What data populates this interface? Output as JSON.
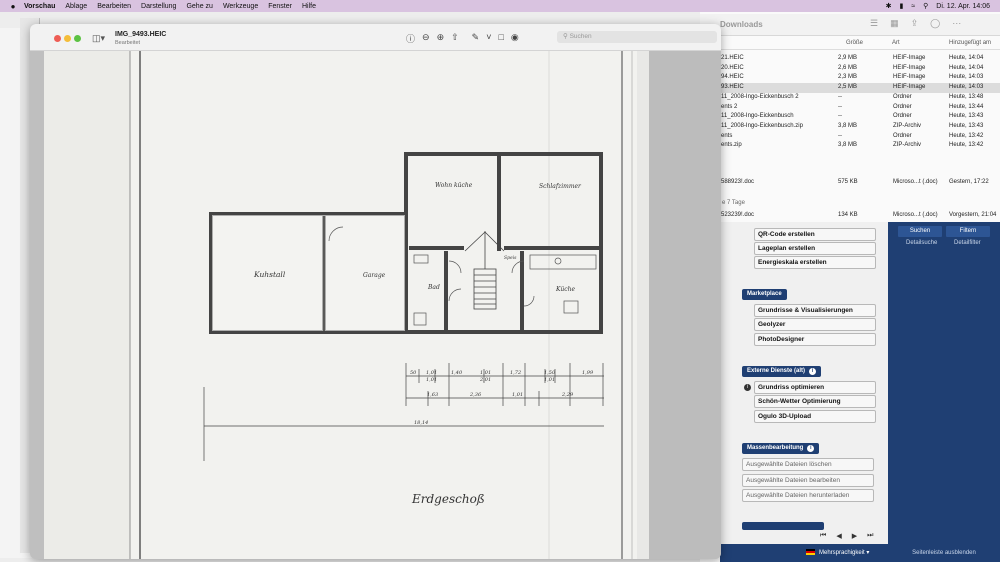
{
  "menubar": {
    "app": "Vorschau",
    "items": [
      "Ablage",
      "Bearbeiten",
      "Darstellung",
      "Gehe zu",
      "Werkzeuge",
      "Fenster",
      "Hilfe"
    ],
    "clock": "Di. 12. Apr.  14:06"
  },
  "preview": {
    "title": "IMG_9493.HEIC",
    "subtitle": "Bearbeitet",
    "search_placeholder": "Suchen"
  },
  "plan": {
    "rooms": {
      "kuhstall": "Kuhstall",
      "garage": "Garage",
      "wohnkuche": "Wohn küche",
      "schlafzimmer": "Schlafzimmer",
      "bad": "Bad",
      "kuche": "Küche",
      "speis": "Speis"
    },
    "dims_top1": [
      "50",
      "1,01",
      "1,40",
      "1,01",
      "1,72",
      "1,50",
      "1,99"
    ],
    "dims_top2": [
      "1,01",
      "1,01",
      "2,01",
      "1,01"
    ],
    "dims_mid": [
      "1,63",
      "2,36",
      "1,01",
      "2,29"
    ],
    "total": "18,14",
    "caption": "Erdgeschoß"
  },
  "finder": {
    "title": "Downloads",
    "columns": {
      "size": "Größe",
      "kind": "Art",
      "date": "Hinzugefügt am"
    },
    "rows": [
      {
        "name": "21.HEIC",
        "size": "2,9 MB",
        "kind": "HEIF-Image",
        "date": "Heute, 14:04"
      },
      {
        "name": "20.HEIC",
        "size": "2,6 MB",
        "kind": "HEIF-Image",
        "date": "Heute, 14:04"
      },
      {
        "name": "94.HEIC",
        "size": "2,3 MB",
        "kind": "HEIF-Image",
        "date": "Heute, 14:03"
      },
      {
        "name": "93.HEIC",
        "size": "2,5 MB",
        "kind": "HEIF-Image",
        "date": "Heute, 14:03"
      },
      {
        "name": "11_2008-Ingo-Eickenbusch 2",
        "size": "--",
        "kind": "Ordner",
        "date": "Heute, 13:48"
      },
      {
        "name": "ents 2",
        "size": "--",
        "kind": "Ordner",
        "date": "Heute, 13:44"
      },
      {
        "name": "11_2008-Ingo-Eickenbusch",
        "size": "--",
        "kind": "Ordner",
        "date": "Heute, 13:43"
      },
      {
        "name": "11_2008-Ingo-Eickenbusch.zip",
        "size": "3,8 MB",
        "kind": "ZIP-Archiv",
        "date": "Heute, 13:43"
      },
      {
        "name": "ents",
        "size": "--",
        "kind": "Ordner",
        "date": "Heute, 13:42"
      },
      {
        "name": "ents.zip",
        "size": "3,8 MB",
        "kind": "ZIP-Archiv",
        "date": "Heute, 13:42"
      }
    ],
    "row_b": {
      "name": "588923!.doc",
      "size": "575 KB",
      "kind": "Microso...t (.doc)",
      "date": "Gestern, 17:22"
    },
    "section": "e 7 Tage",
    "row_c": {
      "name": "523239!.doc",
      "size": "134 KB",
      "kind": "Microso...t (.doc)",
      "date": "Vorgestern, 21:04"
    }
  },
  "webapp": {
    "buttons_top": [
      "QR-Code erstellen",
      "Lageplan erstellen",
      "Energieskala erstellen"
    ],
    "marketplace": "Marketplace",
    "buttons_market": [
      "Grundrisse & Visualisierungen",
      "Geolyzer",
      "PhotoDesigner"
    ],
    "extern": "Externe Dienste (alt)",
    "buttons_extern": [
      "Grundriss optimieren",
      "Schön-Wetter Optimierung",
      "Ogulo 3D-Upload"
    ],
    "mass": "Massenbearbeitung",
    "buttons_mass": [
      "Ausgewählte Dateien löschen",
      "Ausgewählte Dateien bearbeiten",
      "Ausgewählte Dateien herunterladen"
    ],
    "sidebar": {
      "search": "Suchen",
      "filter": "Filtern",
      "detail_search": "Detailsuche",
      "detail_filter": "Detailfilter"
    },
    "language": "Mehrsprachigkeit",
    "hide_sidebar": "Seitenleiste ausblenden"
  }
}
